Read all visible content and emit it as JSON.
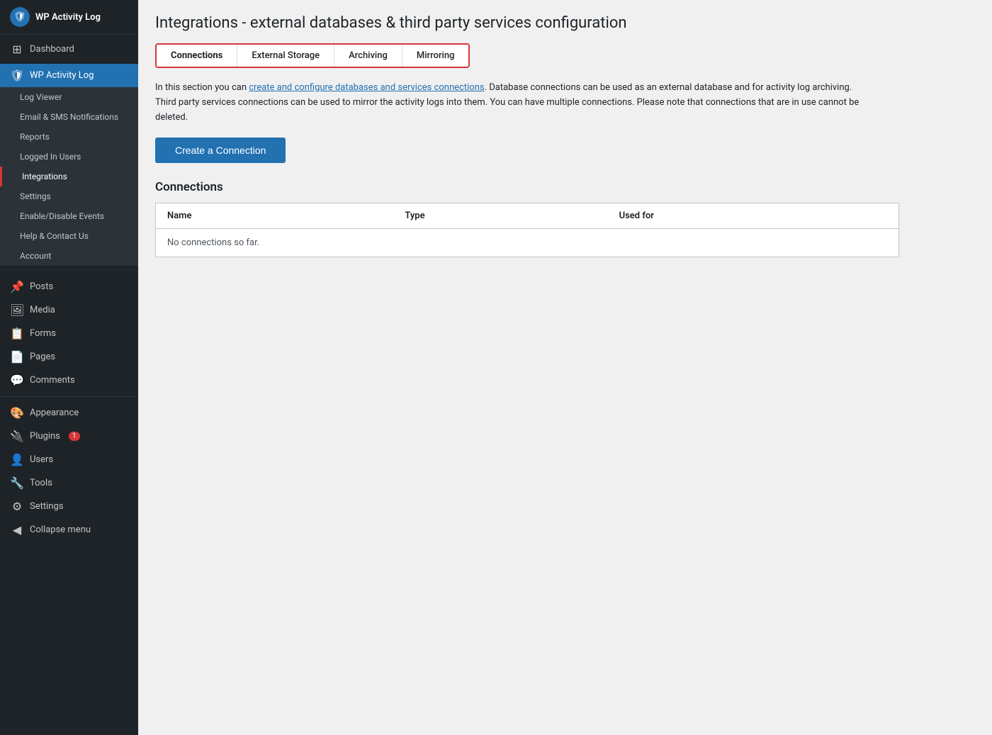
{
  "sidebar": {
    "logo": {
      "icon": "🛡",
      "text": "WP Activity Log"
    },
    "top_items": [
      {
        "id": "dashboard",
        "label": "Dashboard",
        "icon": "⊞"
      },
      {
        "id": "wp-activity-log",
        "label": "WP Activity Log",
        "icon": "🛡",
        "active": true
      }
    ],
    "wp_activity_sub": [
      {
        "id": "log-viewer",
        "label": "Log Viewer"
      },
      {
        "id": "email-sms",
        "label": "Email & SMS Notifications"
      },
      {
        "id": "reports",
        "label": "Reports"
      },
      {
        "id": "logged-in-users",
        "label": "Logged In Users"
      },
      {
        "id": "integrations",
        "label": "Integrations",
        "active_highlight": true
      },
      {
        "id": "settings",
        "label": "Settings"
      },
      {
        "id": "enable-disable-events",
        "label": "Enable/Disable Events"
      },
      {
        "id": "help-contact",
        "label": "Help & Contact Us"
      },
      {
        "id": "account",
        "label": "Account"
      }
    ],
    "wp_items": [
      {
        "id": "posts",
        "label": "Posts",
        "icon": "📌"
      },
      {
        "id": "media",
        "label": "Media",
        "icon": "🖼"
      },
      {
        "id": "forms",
        "label": "Forms",
        "icon": "📋"
      },
      {
        "id": "pages",
        "label": "Pages",
        "icon": "📄"
      },
      {
        "id": "comments",
        "label": "Comments",
        "icon": "💬"
      }
    ],
    "bottom_items": [
      {
        "id": "appearance",
        "label": "Appearance",
        "icon": "🎨"
      },
      {
        "id": "plugins",
        "label": "Plugins",
        "icon": "🔌",
        "badge": "1"
      },
      {
        "id": "users",
        "label": "Users",
        "icon": "👤"
      },
      {
        "id": "tools",
        "label": "Tools",
        "icon": "🔧"
      },
      {
        "id": "settings",
        "label": "Settings",
        "icon": "⚙"
      },
      {
        "id": "collapse",
        "label": "Collapse menu",
        "icon": "◀"
      }
    ]
  },
  "main": {
    "page_title": "Integrations - external databases & third party services configuration",
    "tabs": [
      {
        "id": "connections",
        "label": "Connections",
        "active": true
      },
      {
        "id": "external-storage",
        "label": "External Storage"
      },
      {
        "id": "archiving",
        "label": "Archiving"
      },
      {
        "id": "mirroring",
        "label": "Mirroring"
      }
    ],
    "description": {
      "text_before_link": "In this section you can ",
      "link_text": "create and configure databases and services connections",
      "text_after_link": ". Database connections can be used as an external database and for activity log archiving. Third party services connections can be used to mirror the activity logs into them. You can have multiple connections. Please note that connections that are in use cannot be deleted."
    },
    "create_button_label": "Create a Connection",
    "connections_section_title": "Connections",
    "table": {
      "headers": [
        "Name",
        "Type",
        "Used for"
      ],
      "empty_message": "No connections so far."
    }
  }
}
